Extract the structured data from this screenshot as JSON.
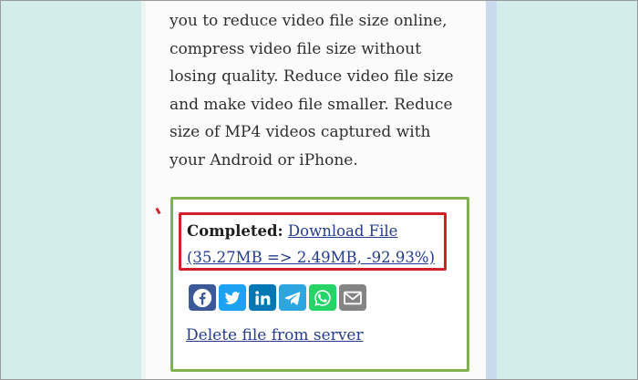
{
  "description": {
    "text": "you to reduce video file size online, compress video file size without losing quality. Reduce video file size and make video file smaller. Reduce size of MP4 videos captured with your Android or iPhone."
  },
  "result": {
    "completed_label": "Completed:",
    "download_link_text": "Download File (35.27MB => 2.49MB, -92.93%)",
    "delete_link_text": "Delete file from server"
  },
  "share_buttons": [
    {
      "name": "facebook-share-button",
      "icon": "facebook-icon",
      "color": "#3b5998"
    },
    {
      "name": "twitter-share-button",
      "icon": "twitter-icon",
      "color": "#1da1f2"
    },
    {
      "name": "linkedin-share-button",
      "icon": "linkedin-icon",
      "color": "#0077b5"
    },
    {
      "name": "telegram-share-button",
      "icon": "telegram-icon",
      "color": "#2ca5e0"
    },
    {
      "name": "whatsapp-share-button",
      "icon": "whatsapp-icon",
      "color": "#25d366"
    },
    {
      "name": "email-share-button",
      "icon": "email-icon",
      "color": "#848484"
    }
  ],
  "colors": {
    "page_background": "#d3ecec",
    "result_border": "#7fb24e",
    "highlight_border": "#d0202a",
    "link": "#263c8c"
  }
}
